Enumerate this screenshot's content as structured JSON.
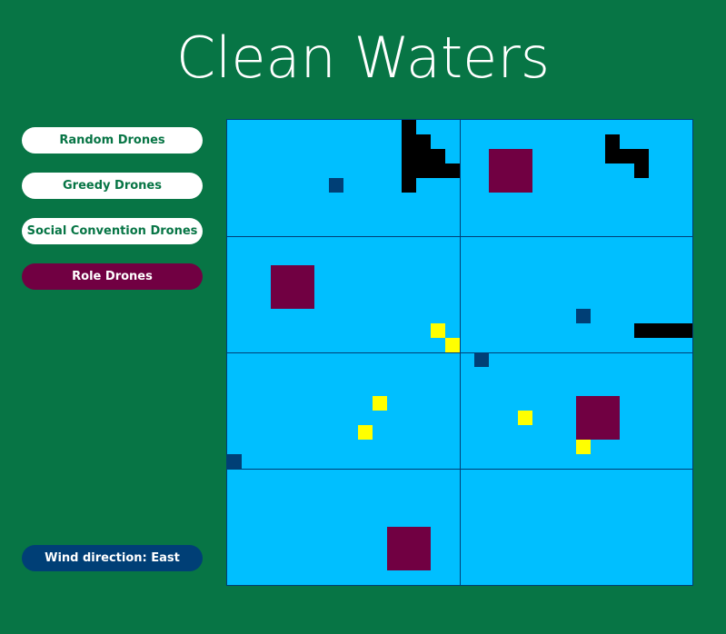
{
  "title": "Clean Waters",
  "buttons": [
    {
      "id": "random",
      "label": "Random Drones",
      "active": false
    },
    {
      "id": "greedy",
      "label": "Greedy Drones",
      "active": false
    },
    {
      "id": "social",
      "label": "Social Convention Drones",
      "active": false
    },
    {
      "id": "role",
      "label": "Role Drones",
      "active": true
    }
  ],
  "wind": {
    "label": "Wind direction: East"
  },
  "colors": {
    "background": "#077545",
    "water": "#00bfff",
    "obstacle": "#000000",
    "station": "#710042",
    "drone": "#003f76",
    "pollution": "#ffff00"
  },
  "grid": {
    "columns": 32,
    "rows": 32,
    "sectors": 8,
    "obstacles": [
      {
        "col": 12,
        "row": 0,
        "w": 1,
        "h": 5
      },
      {
        "col": 13,
        "row": 1,
        "w": 1,
        "h": 3
      },
      {
        "col": 14,
        "row": 2,
        "w": 1,
        "h": 2
      },
      {
        "col": 15,
        "row": 3,
        "w": 1,
        "h": 1
      },
      {
        "col": 26,
        "row": 1,
        "w": 1,
        "h": 2
      },
      {
        "col": 27,
        "row": 2,
        "w": 2,
        "h": 1
      },
      {
        "col": 28,
        "row": 3,
        "w": 1,
        "h": 1
      },
      {
        "col": 28,
        "row": 14,
        "w": 4,
        "h": 1
      }
    ],
    "stations": [
      {
        "col": 18,
        "row": 2
      },
      {
        "col": 3,
        "row": 10
      },
      {
        "col": 24,
        "row": 19
      },
      {
        "col": 11,
        "row": 28
      }
    ],
    "drones": [
      {
        "col": 7,
        "row": 4
      },
      {
        "col": 24,
        "row": 13
      },
      {
        "col": 17,
        "row": 16
      },
      {
        "col": 0,
        "row": 23
      }
    ],
    "pollution": [
      {
        "col": 14,
        "row": 14
      },
      {
        "col": 15,
        "row": 15
      },
      {
        "col": 10,
        "row": 19
      },
      {
        "col": 9,
        "row": 21
      },
      {
        "col": 20,
        "row": 20
      },
      {
        "col": 24,
        "row": 22
      }
    ]
  }
}
